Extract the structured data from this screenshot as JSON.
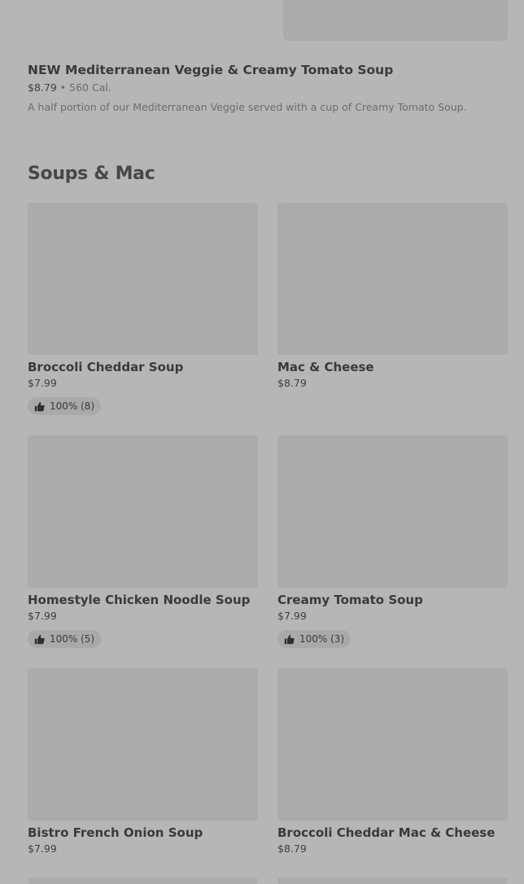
{
  "featured": {
    "name": "NEW Mediterranean Veggie & Creamy Tomato Soup",
    "price": "$8.79",
    "separator": "•",
    "calories": "560 Cal.",
    "description": "A half portion of our Mediterranean Veggie served with a cup of Creamy Tomato Soup."
  },
  "section": {
    "title": "Soups & Mac"
  },
  "items": [
    {
      "name": "Broccoli Cheddar Soup",
      "price": "$7.99",
      "rating": "100% (8)"
    },
    {
      "name": "Mac & Cheese",
      "price": "$8.79",
      "rating": null
    },
    {
      "name": "Homestyle Chicken Noodle Soup",
      "price": "$7.99",
      "rating": "100% (5)"
    },
    {
      "name": "Creamy Tomato Soup",
      "price": "$7.99",
      "rating": "100% (3)"
    },
    {
      "name": "Bistro French Onion Soup",
      "price": "$7.99",
      "rating": null
    },
    {
      "name": "Broccoli Cheddar Mac & Cheese",
      "price": "$8.79",
      "rating": null
    }
  ],
  "icons": {
    "rating": "thumbs-up-icon"
  }
}
